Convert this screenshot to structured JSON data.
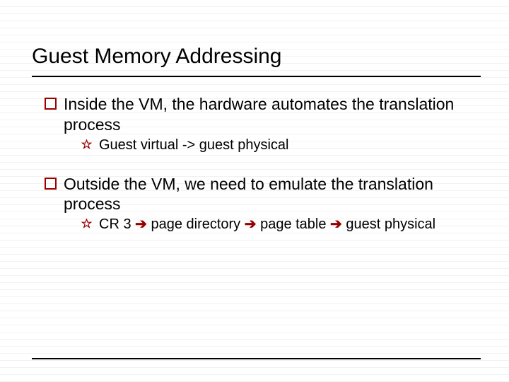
{
  "title": "Guest Memory Addressing",
  "colors": {
    "accent": "#990000"
  },
  "bullets": [
    {
      "level": 1,
      "text": "Inside the VM, the hardware automates the translation process"
    },
    {
      "level": 2,
      "text": "Guest virtual -> guest physical"
    },
    {
      "level": 1,
      "text": "Outside the VM, we need to emulate the translation process"
    },
    {
      "level": 2,
      "segments": [
        "CR 3 ",
        " page directory ",
        " page table ",
        " guest physical"
      ],
      "arrow": "➔"
    }
  ]
}
